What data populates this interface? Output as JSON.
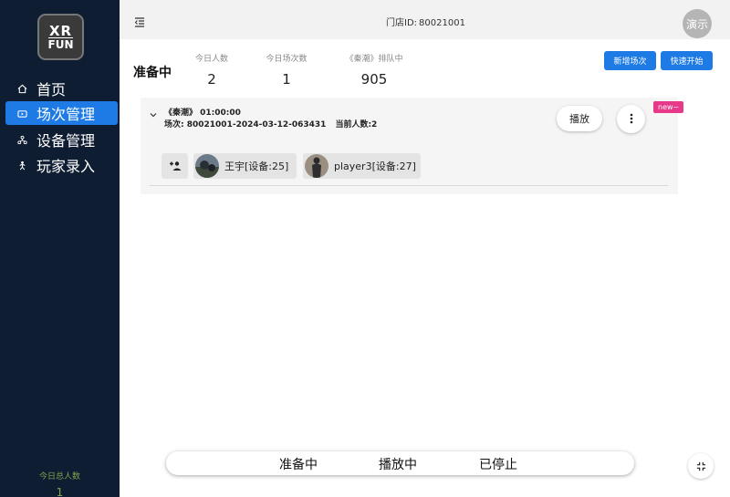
{
  "sidebar": {
    "logo": {
      "line1": "XR",
      "line2": "FUN"
    },
    "items": [
      {
        "label": "首页",
        "icon": "home-icon"
      },
      {
        "label": "场次管理",
        "icon": "session-icon",
        "active": true
      },
      {
        "label": "设备管理",
        "icon": "device-icon"
      },
      {
        "label": "玩家录入",
        "icon": "player-icon"
      }
    ],
    "footer_label": "今日总人数",
    "footer_value": "1"
  },
  "topbar": {
    "store_label": "门店ID:",
    "store_id": "80021001",
    "avatar_text": "演示"
  },
  "header": {
    "status_title": "准备中",
    "stats": [
      {
        "label": "今日人数",
        "value": "2"
      },
      {
        "label": "今日场次数",
        "value": "1"
      },
      {
        "label": "《秦潮》排队中",
        "value": "905"
      }
    ],
    "buttons": {
      "new_session": "新增场次",
      "quick_start": "快速开始"
    }
  },
  "session": {
    "game_line": "《秦潮》 01:00:00",
    "session_label": "场次: 80021001-2024-03-12-063431",
    "current_count": "当前人数:2",
    "play_label": "播放",
    "badge": "new~",
    "players": [
      {
        "name": "王宇[设备:25]"
      },
      {
        "name": "player3[设备:27]"
      }
    ]
  },
  "tabs": [
    "准备中",
    "播放中",
    "已停止"
  ],
  "colors": {
    "sidebar": "#0f1d33",
    "accent": "#1e7be6",
    "badge": "#e8388a"
  }
}
